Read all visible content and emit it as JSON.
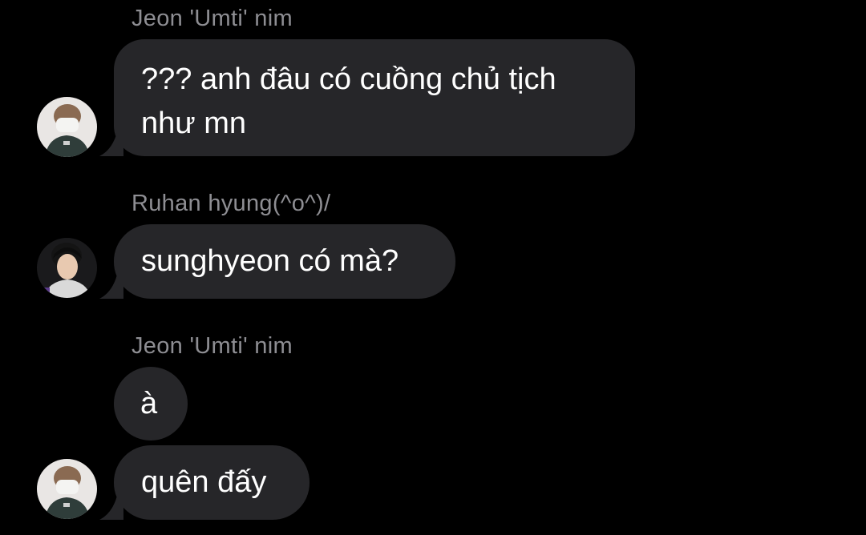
{
  "colors": {
    "background": "#000000",
    "bubble": "#262629",
    "sender_name": "#8e8e93",
    "message_text": "#ffffff"
  },
  "messages": [
    {
      "sender": "Jeon 'Umti' nim",
      "bubbles": [
        {
          "text": "??? anh đâu có cuồng chủ tịch như mn"
        }
      ],
      "avatar": "umti-avatar"
    },
    {
      "sender": "Ruhan hyung(^o^)/",
      "bubbles": [
        {
          "text": "sunghyeon có mà?"
        }
      ],
      "avatar": "ruhan-avatar"
    },
    {
      "sender": "Jeon 'Umti' nim",
      "bubbles": [
        {
          "text": "à"
        },
        {
          "text": "quên đấy"
        }
      ],
      "avatar": "umti-avatar"
    }
  ]
}
